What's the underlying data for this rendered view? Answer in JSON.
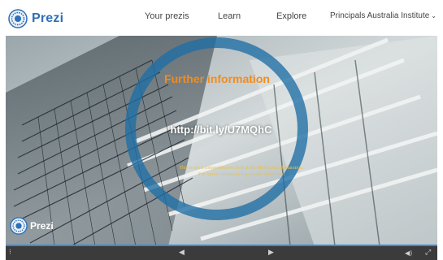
{
  "header": {
    "logo_text": "Prezi",
    "nav": [
      {
        "label": "Your prezis"
      },
      {
        "label": "Learn"
      },
      {
        "label": "Explore"
      }
    ],
    "account_label": "Principals Australia Institute",
    "account_caret": "⌄"
  },
  "frame": {
    "title": "Further information",
    "link": "http://bit.ly/U7MQhC",
    "note": "This is not a comprehensive look at the Melbourne Declaration. For further information go to the above site.",
    "watermark_text": "Prezi"
  },
  "player": {
    "progress_pct": 100,
    "prev_glyph": "◀",
    "next_glyph": "▶",
    "left_glyph": "⁝",
    "volume_glyph": "◀)",
    "fullscreen_glyph": "⤢"
  },
  "colors": {
    "brand": "#2e6fb5",
    "title_orange": "#f28c1e",
    "note_gold": "#e8c24a",
    "ring_blue": "#1e6ea5",
    "bar": "#3b3b3b"
  }
}
